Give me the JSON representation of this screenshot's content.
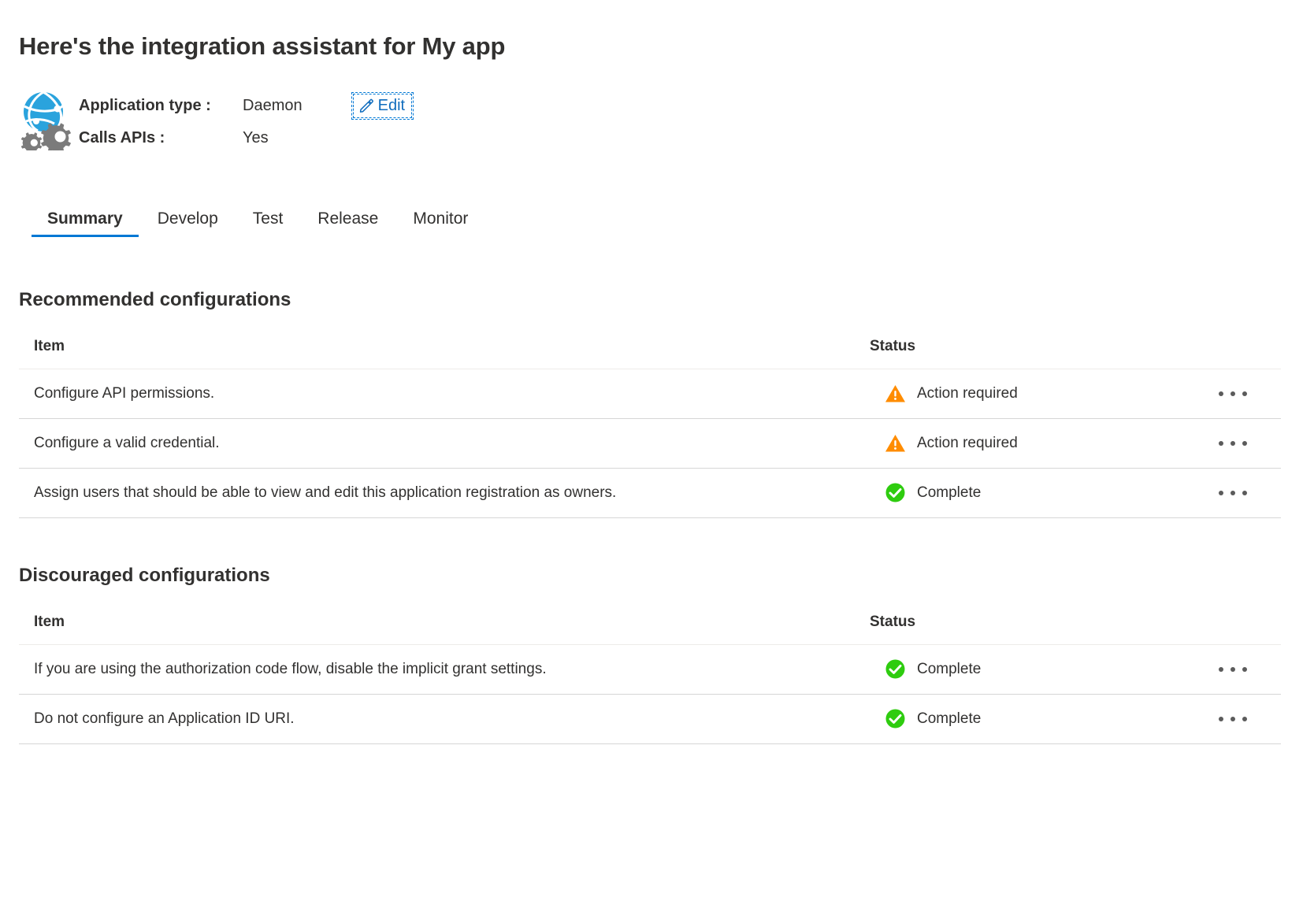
{
  "page_title": "Here's the integration assistant for My app",
  "app_summary": {
    "icon": "daemon-app-globe-gears-icon",
    "application_type_label": "Application type :",
    "application_type_value": "Daemon",
    "calls_apis_label": "Calls APIs :",
    "calls_apis_value": "Yes",
    "edit_label": "Edit",
    "edit_icon": "pencil-icon"
  },
  "tabs": [
    {
      "label": "Summary",
      "active": true
    },
    {
      "label": "Develop",
      "active": false
    },
    {
      "label": "Test",
      "active": false
    },
    {
      "label": "Release",
      "active": false
    },
    {
      "label": "Monitor",
      "active": false
    }
  ],
  "colors": {
    "accent": "#0078d4",
    "link": "#0f6cbd",
    "warning": "#ff8c00",
    "success": "#2ecc0f",
    "text": "#323130",
    "row_border": "#d6d6d6",
    "header_border": "#edebe9"
  },
  "recommended": {
    "heading": "Recommended configurations",
    "columns": {
      "item": "Item",
      "status": "Status"
    },
    "rows": [
      {
        "item": "Configure API permissions.",
        "status": "Action required",
        "status_type": "warning",
        "menu": "more-actions"
      },
      {
        "item": "Configure a valid credential.",
        "status": "Action required",
        "status_type": "warning",
        "menu": "more-actions"
      },
      {
        "item": "Assign users that should be able to view and edit this application registration as owners.",
        "status": "Complete",
        "status_type": "success",
        "menu": "more-actions"
      }
    ]
  },
  "discouraged": {
    "heading": "Discouraged configurations",
    "columns": {
      "item": "Item",
      "status": "Status"
    },
    "rows": [
      {
        "item": "If you are using the authorization code flow, disable the implicit grant settings.",
        "status": "Complete",
        "status_type": "success",
        "menu": "more-actions"
      },
      {
        "item": "Do not configure an Application ID URI.",
        "status": "Complete",
        "status_type": "success",
        "menu": "more-actions"
      }
    ]
  }
}
